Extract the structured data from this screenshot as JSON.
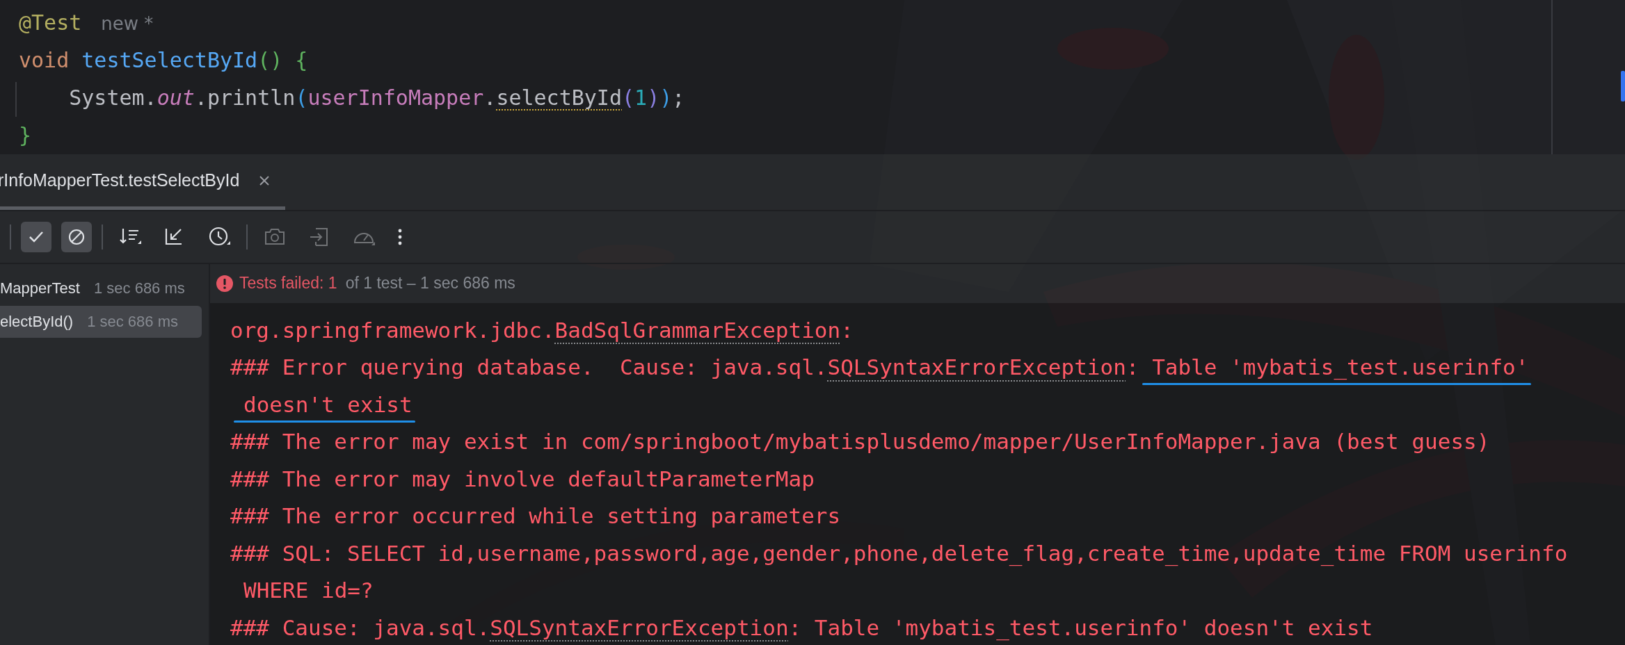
{
  "editor": {
    "lines": [
      [
        {
          "kind": "annotation",
          "text": "@Test"
        },
        {
          "kind": "hint",
          "text": "new *"
        }
      ],
      [
        {
          "kind": "keyword",
          "text": "void "
        },
        {
          "kind": "method",
          "text": "testSelectById"
        },
        {
          "kind": "brace",
          "text": "() {"
        }
      ],
      [
        {
          "kind": "plain",
          "text": "    System."
        },
        {
          "kind": "field",
          "text": "out"
        },
        {
          "kind": "plain",
          "text": ".println"
        },
        {
          "kind": "paren1",
          "text": "("
        },
        {
          "kind": "variable",
          "text": "userInfoMapper"
        },
        {
          "kind": "plain",
          "text": "."
        },
        {
          "kind": "call",
          "text": "selectById",
          "warning": true
        },
        {
          "kind": "paren2",
          "text": "("
        },
        {
          "kind": "number",
          "text": "1"
        },
        {
          "kind": "paren2",
          "text": ")"
        },
        {
          "kind": "paren1",
          "text": ")"
        },
        {
          "kind": "plain",
          "text": ";"
        }
      ],
      [
        {
          "kind": "brace",
          "text": "}"
        }
      ]
    ]
  },
  "run_tab": {
    "label": "rInfoMapperTest.testSelectById",
    "selected": true
  },
  "toolbar": {
    "show_passed": {
      "selected": true
    },
    "show_ignored": {
      "selected": true
    },
    "snapshot": {
      "disabled": true
    },
    "import": {
      "disabled": true
    },
    "coverage": {
      "disabled": true
    }
  },
  "tree": [
    {
      "name": "MapperTest",
      "time": "1 sec 686 ms",
      "selected": false
    },
    {
      "name": "electById()",
      "time": "1 sec 686 ms",
      "selected": true
    }
  ],
  "status": {
    "failed": "Tests failed: 1",
    "summary": "of 1 test – 1 sec 686 ms"
  },
  "console": [
    {
      "wrapped": false,
      "parts": [
        {
          "text": "org.springframework.jdbc."
        },
        {
          "text": "BadSqlGrammarException",
          "link": true
        },
        {
          "text": ":"
        }
      ]
    },
    {
      "wrapped": false,
      "parts": [
        {
          "text": "### Error querying database.  Cause: java.sql."
        },
        {
          "text": "SQLSyntaxErrorException",
          "link": true
        },
        {
          "text": ": "
        },
        {
          "text": "Table 'mybatis_test.userinfo'",
          "annotated": true
        }
      ]
    },
    {
      "wrapped": true,
      "parts": [
        {
          "text": "doesn't exist",
          "annotated": true
        }
      ]
    },
    {
      "wrapped": false,
      "parts": [
        {
          "text": "### The error may exist in com/springboot/mybatisplusdemo/mapper/UserInfoMapper.java (best guess)"
        }
      ]
    },
    {
      "wrapped": false,
      "parts": [
        {
          "text": "### The error may involve defaultParameterMap"
        }
      ]
    },
    {
      "wrapped": false,
      "parts": [
        {
          "text": "### The error occurred while setting parameters"
        }
      ]
    },
    {
      "wrapped": false,
      "parts": [
        {
          "text": "### SQL: SELECT id,username,password,age,gender,phone,delete_flag,create_time,update_time FROM userinfo"
        }
      ]
    },
    {
      "wrapped": true,
      "parts": [
        {
          "text": "WHERE id=?"
        }
      ]
    },
    {
      "wrapped": false,
      "parts": [
        {
          "text": "### Cause: java.sql."
        },
        {
          "text": "SQLSyntaxErrorException",
          "link": true
        },
        {
          "text": ": Table 'mybatis_test.userinfo' doesn't exist"
        }
      ]
    }
  ]
}
